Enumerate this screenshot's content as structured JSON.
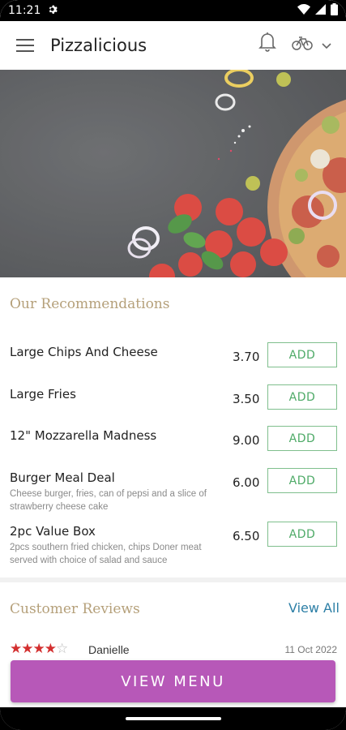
{
  "status_bar": {
    "time": "11:21"
  },
  "app_bar": {
    "title": "Pizzalicious"
  },
  "recommendations": {
    "title": "Our Recommendations",
    "items": [
      {
        "name": "Large Chips And Cheese",
        "description": "",
        "price": "3.70",
        "button": "ADD"
      },
      {
        "name": "Large Fries",
        "description": "",
        "price": "3.50",
        "button": "ADD"
      },
      {
        "name": "12\" Mozzarella Madness",
        "description": "",
        "price": "9.00",
        "button": "ADD"
      },
      {
        "name": "Burger Meal Deal",
        "description": "Cheese burger, fries, can of pepsi and a slice of strawberry cheese cake",
        "price": "6.00",
        "button": "ADD"
      },
      {
        "name": "2pc Value Box",
        "description": "2pcs southern fried chicken, chips Doner meat served with choice of salad and sauce",
        "price": "6.50",
        "button": "ADD"
      }
    ]
  },
  "reviews": {
    "title": "Customer Reviews",
    "view_all": "View All",
    "items": [
      {
        "reviewer": "Danielle",
        "date": "11 Oct 2022",
        "rating": 4,
        "max_rating": 5
      }
    ]
  },
  "view_menu_button": "VIEW MENU",
  "icons": [
    "settings-icon",
    "wifi-icon",
    "signal-icon",
    "battery-icon",
    "menu-icon",
    "bell-icon",
    "bicycle-icon",
    "chevron-down-icon",
    "star-icon"
  ],
  "colors": {
    "accent": "#b758b8",
    "add_green": "#4eaa67",
    "section_title": "#b5a07a",
    "link_blue": "#2d7fa6",
    "star_red": "#d32f2f"
  }
}
